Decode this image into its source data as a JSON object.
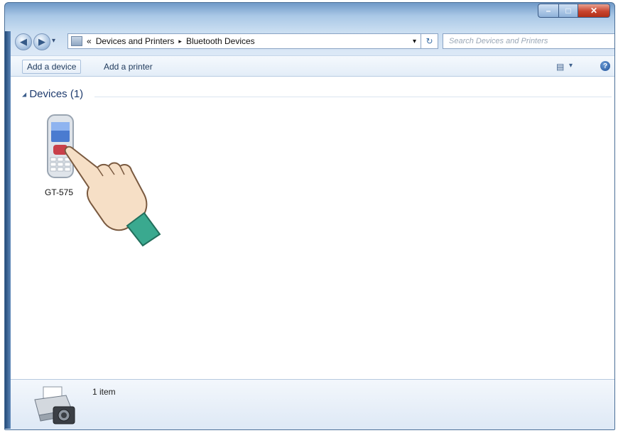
{
  "window": {
    "caption": {
      "min": "–",
      "max": "□",
      "close": "✕"
    }
  },
  "address": {
    "chevron": "«",
    "crumb1": "Devices and Printers",
    "sep": "▸",
    "crumb2": "Bluetooth Devices",
    "dropdown": "▾",
    "refresh": "↻",
    "search_placeholder": "Search Devices and Printers"
  },
  "toolbar": {
    "add_device": "Add a device",
    "add_printer": "Add a printer",
    "view_icon": "▤",
    "view_caret": "▾",
    "help_icon": "?"
  },
  "content": {
    "group_arrow": "◢",
    "group_label": "Devices (1)",
    "device_name": "GT-575"
  },
  "status": {
    "items": "1 item"
  }
}
